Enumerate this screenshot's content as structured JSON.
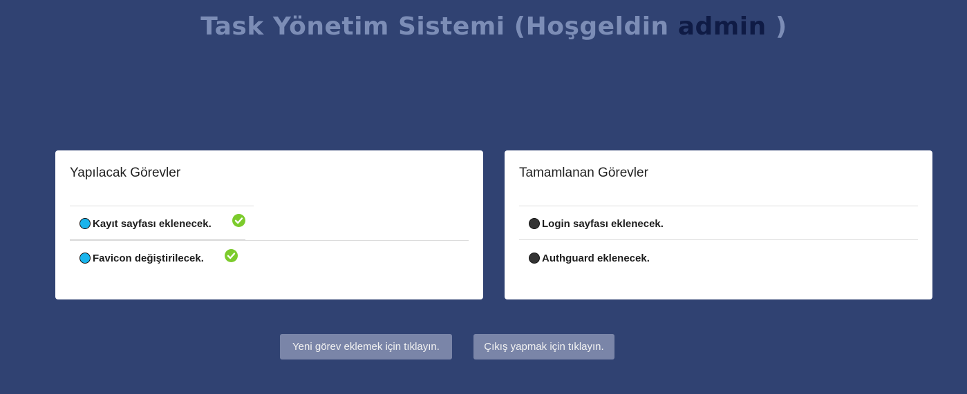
{
  "header": {
    "title_prefix": "Task Yönetim Sistemi (Hoşgeldin",
    "user_name": "admin",
    "title_suffix": ")"
  },
  "pending_panel": {
    "title": "Yapılacak Görevler",
    "tasks": [
      {
        "label": "Kayıt sayfası eklenecek."
      },
      {
        "label": "Favicon değiştirilecek."
      }
    ]
  },
  "completed_panel": {
    "title": "Tamamlanan Görevler",
    "tasks": [
      {
        "label": "Login sayfası eklenecek."
      },
      {
        "label": "Authguard eklenecek."
      }
    ]
  },
  "actions": {
    "add_task_label": "Yeni görev eklemek için tıklayın.",
    "logout_label": "Çıkış yapmak için tıklayın."
  },
  "colors": {
    "background": "#304272",
    "title": "#7c8db6",
    "user_name": "#0f1b45",
    "pending_bullet": "#19b4ec",
    "completed_bullet": "#333333",
    "complete_icon": "#7ccb2c",
    "button": "#7a85a8"
  },
  "icons": {
    "complete_action": "check-circle-icon",
    "pending_bullet": "circle-bullet-icon",
    "completed_bullet": "circle-bullet-icon"
  }
}
